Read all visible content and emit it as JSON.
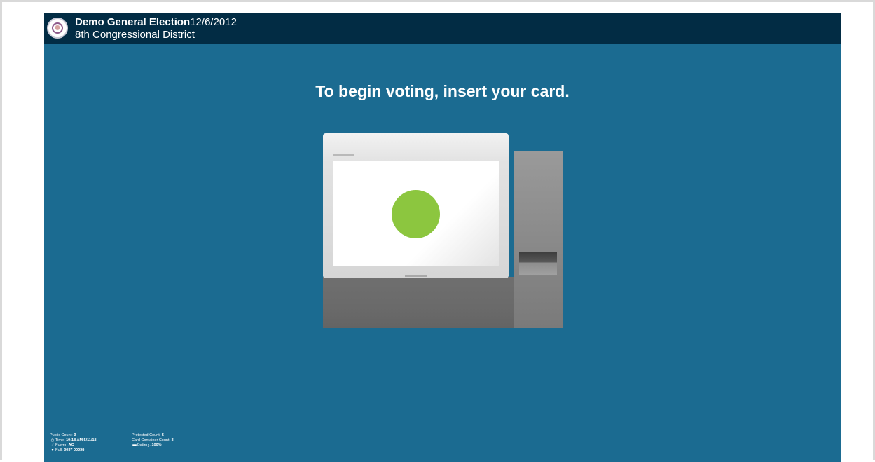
{
  "header": {
    "election_name": "Demo General Election",
    "election_date": "12/6/2012",
    "district": "8th Congressional District",
    "seal_icon": "county-seal-icon"
  },
  "main": {
    "prompt": "To begin voting, insert your card."
  },
  "status": {
    "public_count_label": "Public Count:",
    "public_count_value": "3",
    "time_label": "Time:",
    "time_value": "10:18 AM 5/11/18",
    "power_label": "Power:",
    "power_value": "AC",
    "poll_label": "Poll:",
    "poll_value": "0037 00038",
    "protected_count_label": "Protected Count:",
    "protected_count_value": "5",
    "card_container_label": "Card Container Count:",
    "card_container_value": "3",
    "battery_label": "Battery:",
    "battery_value": "100%"
  },
  "colors": {
    "background": "#1b6b91",
    "header": "#022c44",
    "indicator": "#8cc63f"
  }
}
